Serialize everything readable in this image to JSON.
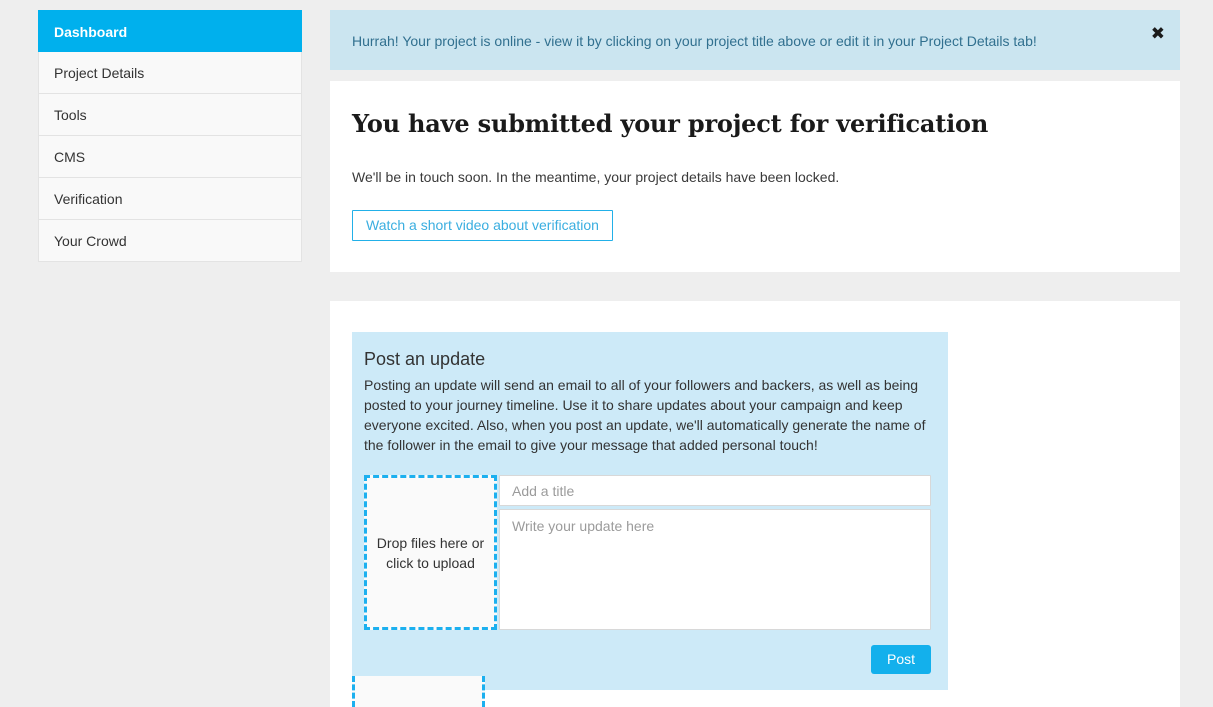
{
  "sidebar": {
    "items": [
      {
        "label": "Dashboard",
        "active": true
      },
      {
        "label": "Project Details",
        "active": false
      },
      {
        "label": "Tools",
        "active": false
      },
      {
        "label": "CMS",
        "active": false
      },
      {
        "label": "Verification",
        "active": false
      },
      {
        "label": "Your Crowd",
        "active": false
      }
    ]
  },
  "alert": {
    "message": "Hurrah! Your project is online - view it by clicking on your project title above or edit it in your Project Details tab!",
    "close_label": "✖"
  },
  "verification": {
    "headline": "You have submitted your project for verification",
    "subtext": "We'll be in touch soon. In the meantime, your project details have been locked.",
    "video_button_label": "Watch a short video about verification"
  },
  "update_panel": {
    "title": "Post an update",
    "description": "Posting an update will send an email to all of your followers and backers, as well as being posted to your journey timeline. Use it to share updates about your campaign and keep everyone excited. Also, when you post an update, we'll automatically generate the name of the follower in the email to give your message that added personal touch!",
    "dropzone_label": "Drop files here or click to upload",
    "title_placeholder": "Add a title",
    "body_placeholder": "Write your update here",
    "title_value": "",
    "body_value": "",
    "post_button_label": "Post"
  },
  "colors": {
    "accent": "#00b0ed",
    "accent_button": "#13b0ec",
    "alert_bg": "#cbe5f0",
    "alert_text": "#31708f",
    "panel_bg": "#cdeaf8",
    "page_bg": "#eeeeee",
    "card_bg": "#ffffff",
    "dashed_border": "#1cb0ef",
    "nav_bg": "#f9f9f9",
    "nav_border": "#e3e3e3"
  }
}
